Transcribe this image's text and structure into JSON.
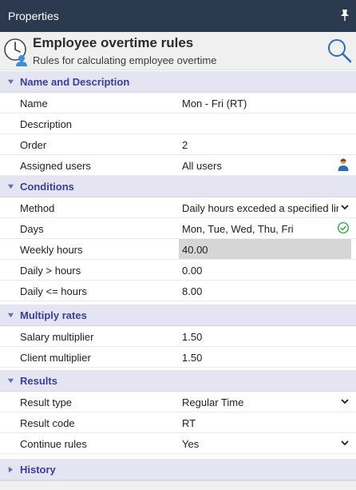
{
  "panel": {
    "title": "Properties"
  },
  "header": {
    "title": "Employee overtime rules",
    "subtitle": "Rules for calculating employee overtime"
  },
  "sections": {
    "name_description": {
      "title": "Name and Description",
      "expanded": true,
      "fields": {
        "name": {
          "label": "Name",
          "value": "Mon - Fri (RT)"
        },
        "description": {
          "label": "Description",
          "value": ""
        },
        "order": {
          "label": "Order",
          "value": "2"
        },
        "assigned_users": {
          "label": "Assigned users",
          "value": "All users",
          "icon": "user-icon"
        }
      }
    },
    "conditions": {
      "title": "Conditions",
      "expanded": true,
      "fields": {
        "method": {
          "label": "Method",
          "value": "Daily hours exceded a specified limit"
        },
        "days": {
          "label": "Days",
          "value": "Mon, Tue, Wed, Thu, Fri",
          "icon": "check-circle-icon"
        },
        "weekly_hours": {
          "label": "Weekly hours",
          "value": "40.00"
        },
        "daily_gt_hours": {
          "label": "Daily > hours",
          "value": "0.00"
        },
        "daily_lte_hours": {
          "label": "Daily <= hours",
          "value": "8.00"
        }
      }
    },
    "multiply_rates": {
      "title": "Multiply rates",
      "expanded": true,
      "fields": {
        "salary_multiplier": {
          "label": "Salary multiplier",
          "value": "1.50"
        },
        "client_multiplier": {
          "label": "Client multiplier",
          "value": "1.50"
        }
      }
    },
    "results": {
      "title": "Results",
      "expanded": true,
      "fields": {
        "result_type": {
          "label": "Result type",
          "value": "Regular Time"
        },
        "result_code": {
          "label": "Result code",
          "value": "RT"
        },
        "continue_rules": {
          "label": "Continue rules",
          "value": "Yes"
        }
      }
    },
    "history": {
      "title": "History",
      "expanded": false
    }
  },
  "colors": {
    "titlebar_bg": "#2b3a4f",
    "section_bg": "#e4e4f3",
    "section_text": "#3b3e96",
    "icon_blue": "#2f6db5",
    "check_green": "#3aa64a",
    "selected_field_bg": "#d6d6d6"
  }
}
